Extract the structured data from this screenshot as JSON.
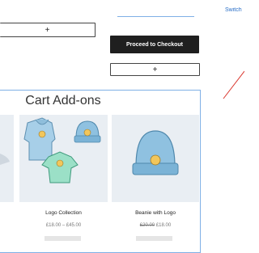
{
  "header": {
    "switch_link": "Switch t"
  },
  "cart": {
    "qty_plus_left": "+",
    "checkout_label": "Proceed to Checkout",
    "qty_plus_right": "+"
  },
  "addons": {
    "title": "Cart Add-ons",
    "products": [
      {
        "name": "Logo Collection",
        "price": "£18.00 – £45.00",
        "old_price": "",
        "new_price": ""
      },
      {
        "name": "Beanie with Logo",
        "price": "",
        "old_price": "£20.00",
        "new_price": "£18.00"
      }
    ]
  },
  "colors": {
    "panel_border": "#7fb0e6",
    "checkout_bg": "#1f1f1f",
    "link": "#2a6fc7",
    "annotation": "#d9342b"
  }
}
